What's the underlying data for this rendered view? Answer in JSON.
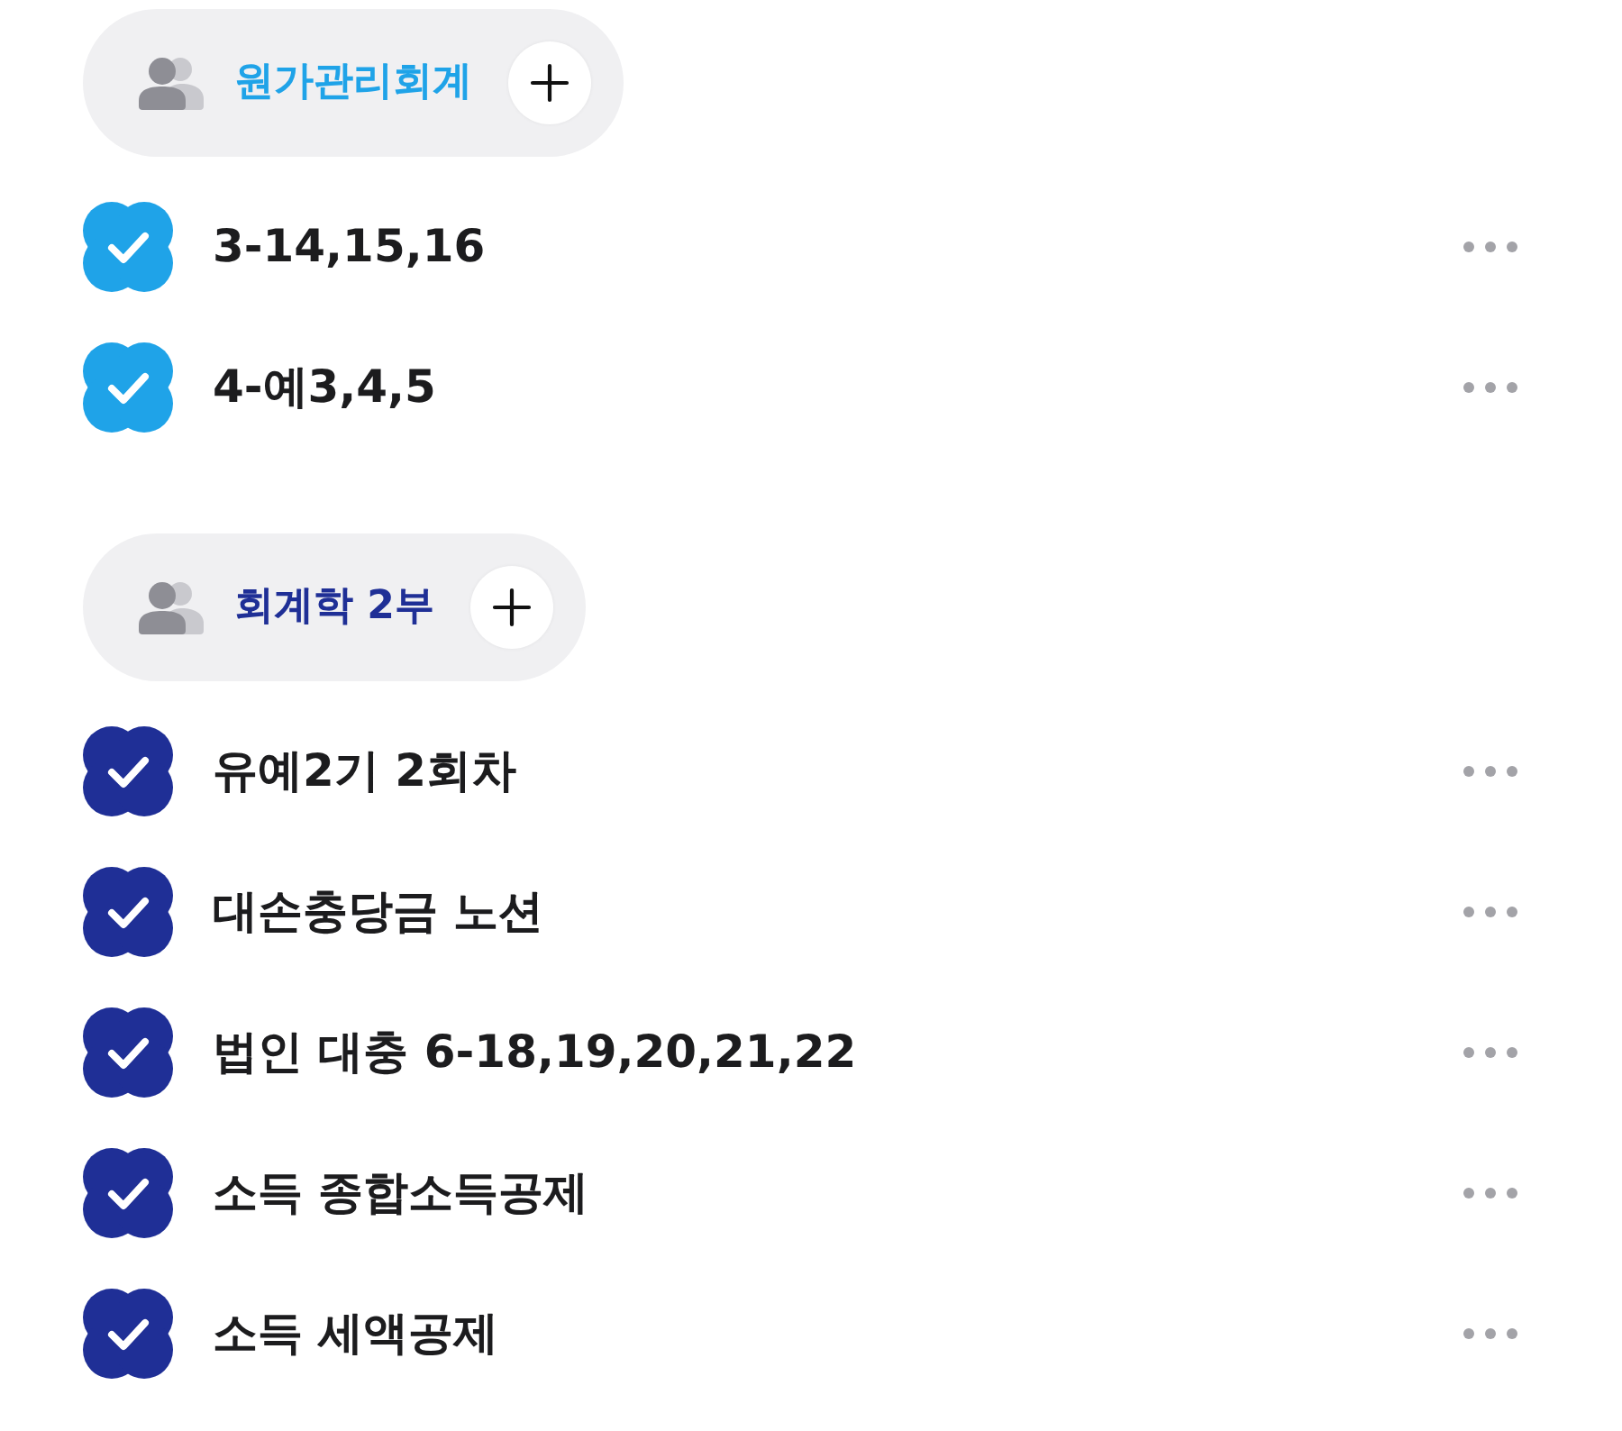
{
  "groups": [
    {
      "title": "원가관리회계",
      "color": "#1fa3e8",
      "tasks": [
        {
          "text": "3-14,15,16",
          "checked": true
        },
        {
          "text": "4-예3,4,5",
          "checked": true
        }
      ]
    },
    {
      "title": "회계학 2부",
      "color": "#1f2f96",
      "tasks": [
        {
          "text": "유예2기 2회차",
          "checked": true
        },
        {
          "text": "대손충당금 노션",
          "checked": true
        },
        {
          "text": "법인 대충 6-18,19,20,21,22",
          "checked": true
        },
        {
          "text": "소득 종합소득공제",
          "checked": true
        },
        {
          "text": "소득 세액공제",
          "checked": true
        }
      ]
    }
  ]
}
